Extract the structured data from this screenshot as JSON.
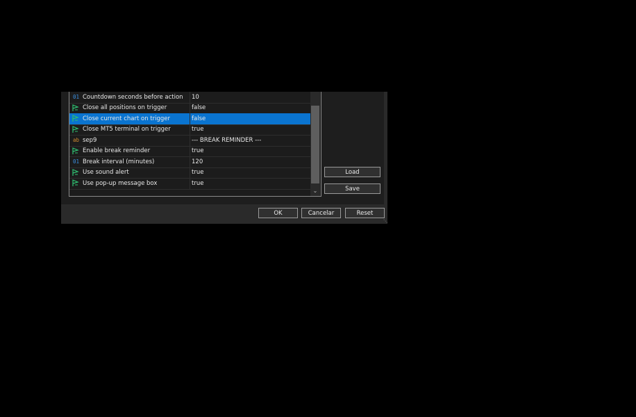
{
  "params": [
    {
      "icon": "int-icon",
      "glyph": "01",
      "type": "int",
      "name": "Countdown seconds before action",
      "value": "10"
    },
    {
      "icon": "bool-icon",
      "glyph": "",
      "type": "bool",
      "name": "Close all positions on trigger",
      "value": "false"
    },
    {
      "icon": "bool-icon",
      "glyph": "",
      "type": "bool",
      "name": "Close current chart on trigger",
      "value": "false",
      "selected": true
    },
    {
      "icon": "bool-icon",
      "glyph": "",
      "type": "bool",
      "name": "Close MT5 terminal on trigger",
      "value": "true"
    },
    {
      "icon": "string-icon",
      "glyph": "ab",
      "type": "str",
      "name": "sep9",
      "value": "--- BREAK REMINDER ---"
    },
    {
      "icon": "bool-icon",
      "glyph": "",
      "type": "bool",
      "name": "Enable break reminder",
      "value": "true"
    },
    {
      "icon": "int-icon",
      "glyph": "01",
      "type": "int",
      "name": "Break interval (minutes)",
      "value": "120"
    },
    {
      "icon": "bool-icon",
      "glyph": "",
      "type": "bool",
      "name": "Use sound alert",
      "value": "true"
    },
    {
      "icon": "bool-icon",
      "glyph": "",
      "type": "bool",
      "name": "Use pop-up message box",
      "value": "true"
    }
  ],
  "side_buttons": {
    "load": "Load",
    "save": "Save"
  },
  "footer_buttons": {
    "ok": "OK",
    "cancel": "Cancelar",
    "reset": "Reset"
  },
  "colors": {
    "selected_row": "#0a74d0",
    "bool_icon": "#2fbf71",
    "int_icon": "#3b8fe0",
    "string_icon": "#d08a30"
  }
}
